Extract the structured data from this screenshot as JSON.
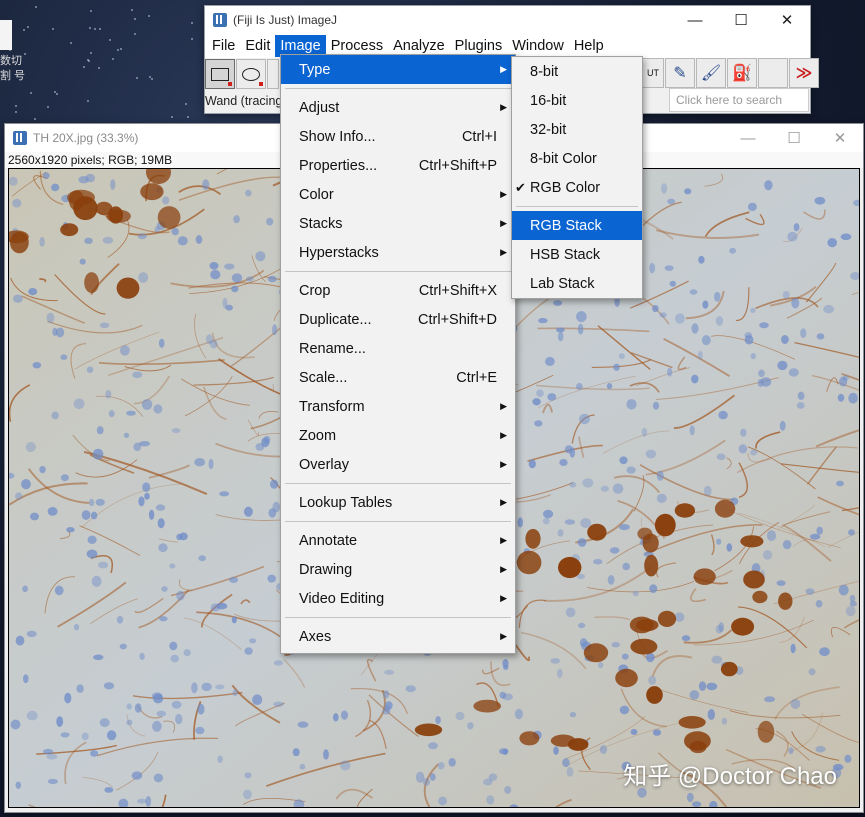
{
  "desktop": {
    "side_text": "数切割 号"
  },
  "imagej": {
    "title": "(Fiji Is Just) ImageJ",
    "menus": [
      "File",
      "Edit",
      "Image",
      "Process",
      "Analyze",
      "Plugins",
      "Window",
      "Help"
    ],
    "active_menu": "Image",
    "status": "Wand (tracing",
    "search_placeholder": "Click here to search",
    "window_controls": {
      "minimize": "—",
      "maximize": "☐",
      "close": "✕"
    },
    "more_tools": "≫"
  },
  "image_window": {
    "title": "TH 20X.jpg (33.3%)",
    "info": "2560x1920 pixels; RGB; 19MB",
    "watermark": "知乎 @Doctor Chao",
    "window_controls": {
      "minimize": "—",
      "maximize": "☐",
      "close": "✕"
    }
  },
  "image_menu": {
    "items": [
      {
        "label": "Type",
        "shortcut": "",
        "submenu": true,
        "highlighted": true
      },
      {
        "separator": true
      },
      {
        "label": "Adjust",
        "shortcut": "",
        "submenu": true
      },
      {
        "label": "Show Info...",
        "shortcut": "Ctrl+I",
        "submenu": false
      },
      {
        "label": "Properties...",
        "shortcut": "Ctrl+Shift+P",
        "submenu": false
      },
      {
        "label": "Color",
        "shortcut": "",
        "submenu": true
      },
      {
        "label": "Stacks",
        "shortcut": "",
        "submenu": true
      },
      {
        "label": "Hyperstacks",
        "shortcut": "",
        "submenu": true
      },
      {
        "separator": true
      },
      {
        "label": "Crop",
        "shortcut": "Ctrl+Shift+X",
        "submenu": false
      },
      {
        "label": "Duplicate...",
        "shortcut": "Ctrl+Shift+D",
        "submenu": false
      },
      {
        "label": "Rename...",
        "shortcut": "",
        "submenu": false
      },
      {
        "label": "Scale...",
        "shortcut": "Ctrl+E",
        "submenu": false
      },
      {
        "label": "Transform",
        "shortcut": "",
        "submenu": true
      },
      {
        "label": "Zoom",
        "shortcut": "",
        "submenu": true
      },
      {
        "label": "Overlay",
        "shortcut": "",
        "submenu": true
      },
      {
        "separator": true
      },
      {
        "label": "Lookup Tables",
        "shortcut": "",
        "submenu": true
      },
      {
        "separator": true
      },
      {
        "label": "Annotate",
        "shortcut": "",
        "submenu": true
      },
      {
        "label": "Drawing",
        "shortcut": "",
        "submenu": true
      },
      {
        "label": "Video Editing",
        "shortcut": "",
        "submenu": true
      },
      {
        "separator": true
      },
      {
        "label": "Axes",
        "shortcut": "",
        "submenu": true
      }
    ]
  },
  "type_submenu": {
    "items": [
      {
        "label": "8-bit",
        "checked": false
      },
      {
        "label": "16-bit",
        "checked": false
      },
      {
        "label": "32-bit",
        "checked": false
      },
      {
        "label": "8-bit Color",
        "checked": false
      },
      {
        "label": "RGB Color",
        "checked": true
      },
      {
        "separator": true
      },
      {
        "label": "RGB Stack",
        "checked": false,
        "highlighted": true
      },
      {
        "label": "HSB Stack",
        "checked": false
      },
      {
        "label": "Lab Stack",
        "checked": false
      }
    ]
  },
  "colors": {
    "accent": "#0a64d2",
    "stain_brown": "#a0521a",
    "nuclei_blue": "#6f8cc8"
  }
}
